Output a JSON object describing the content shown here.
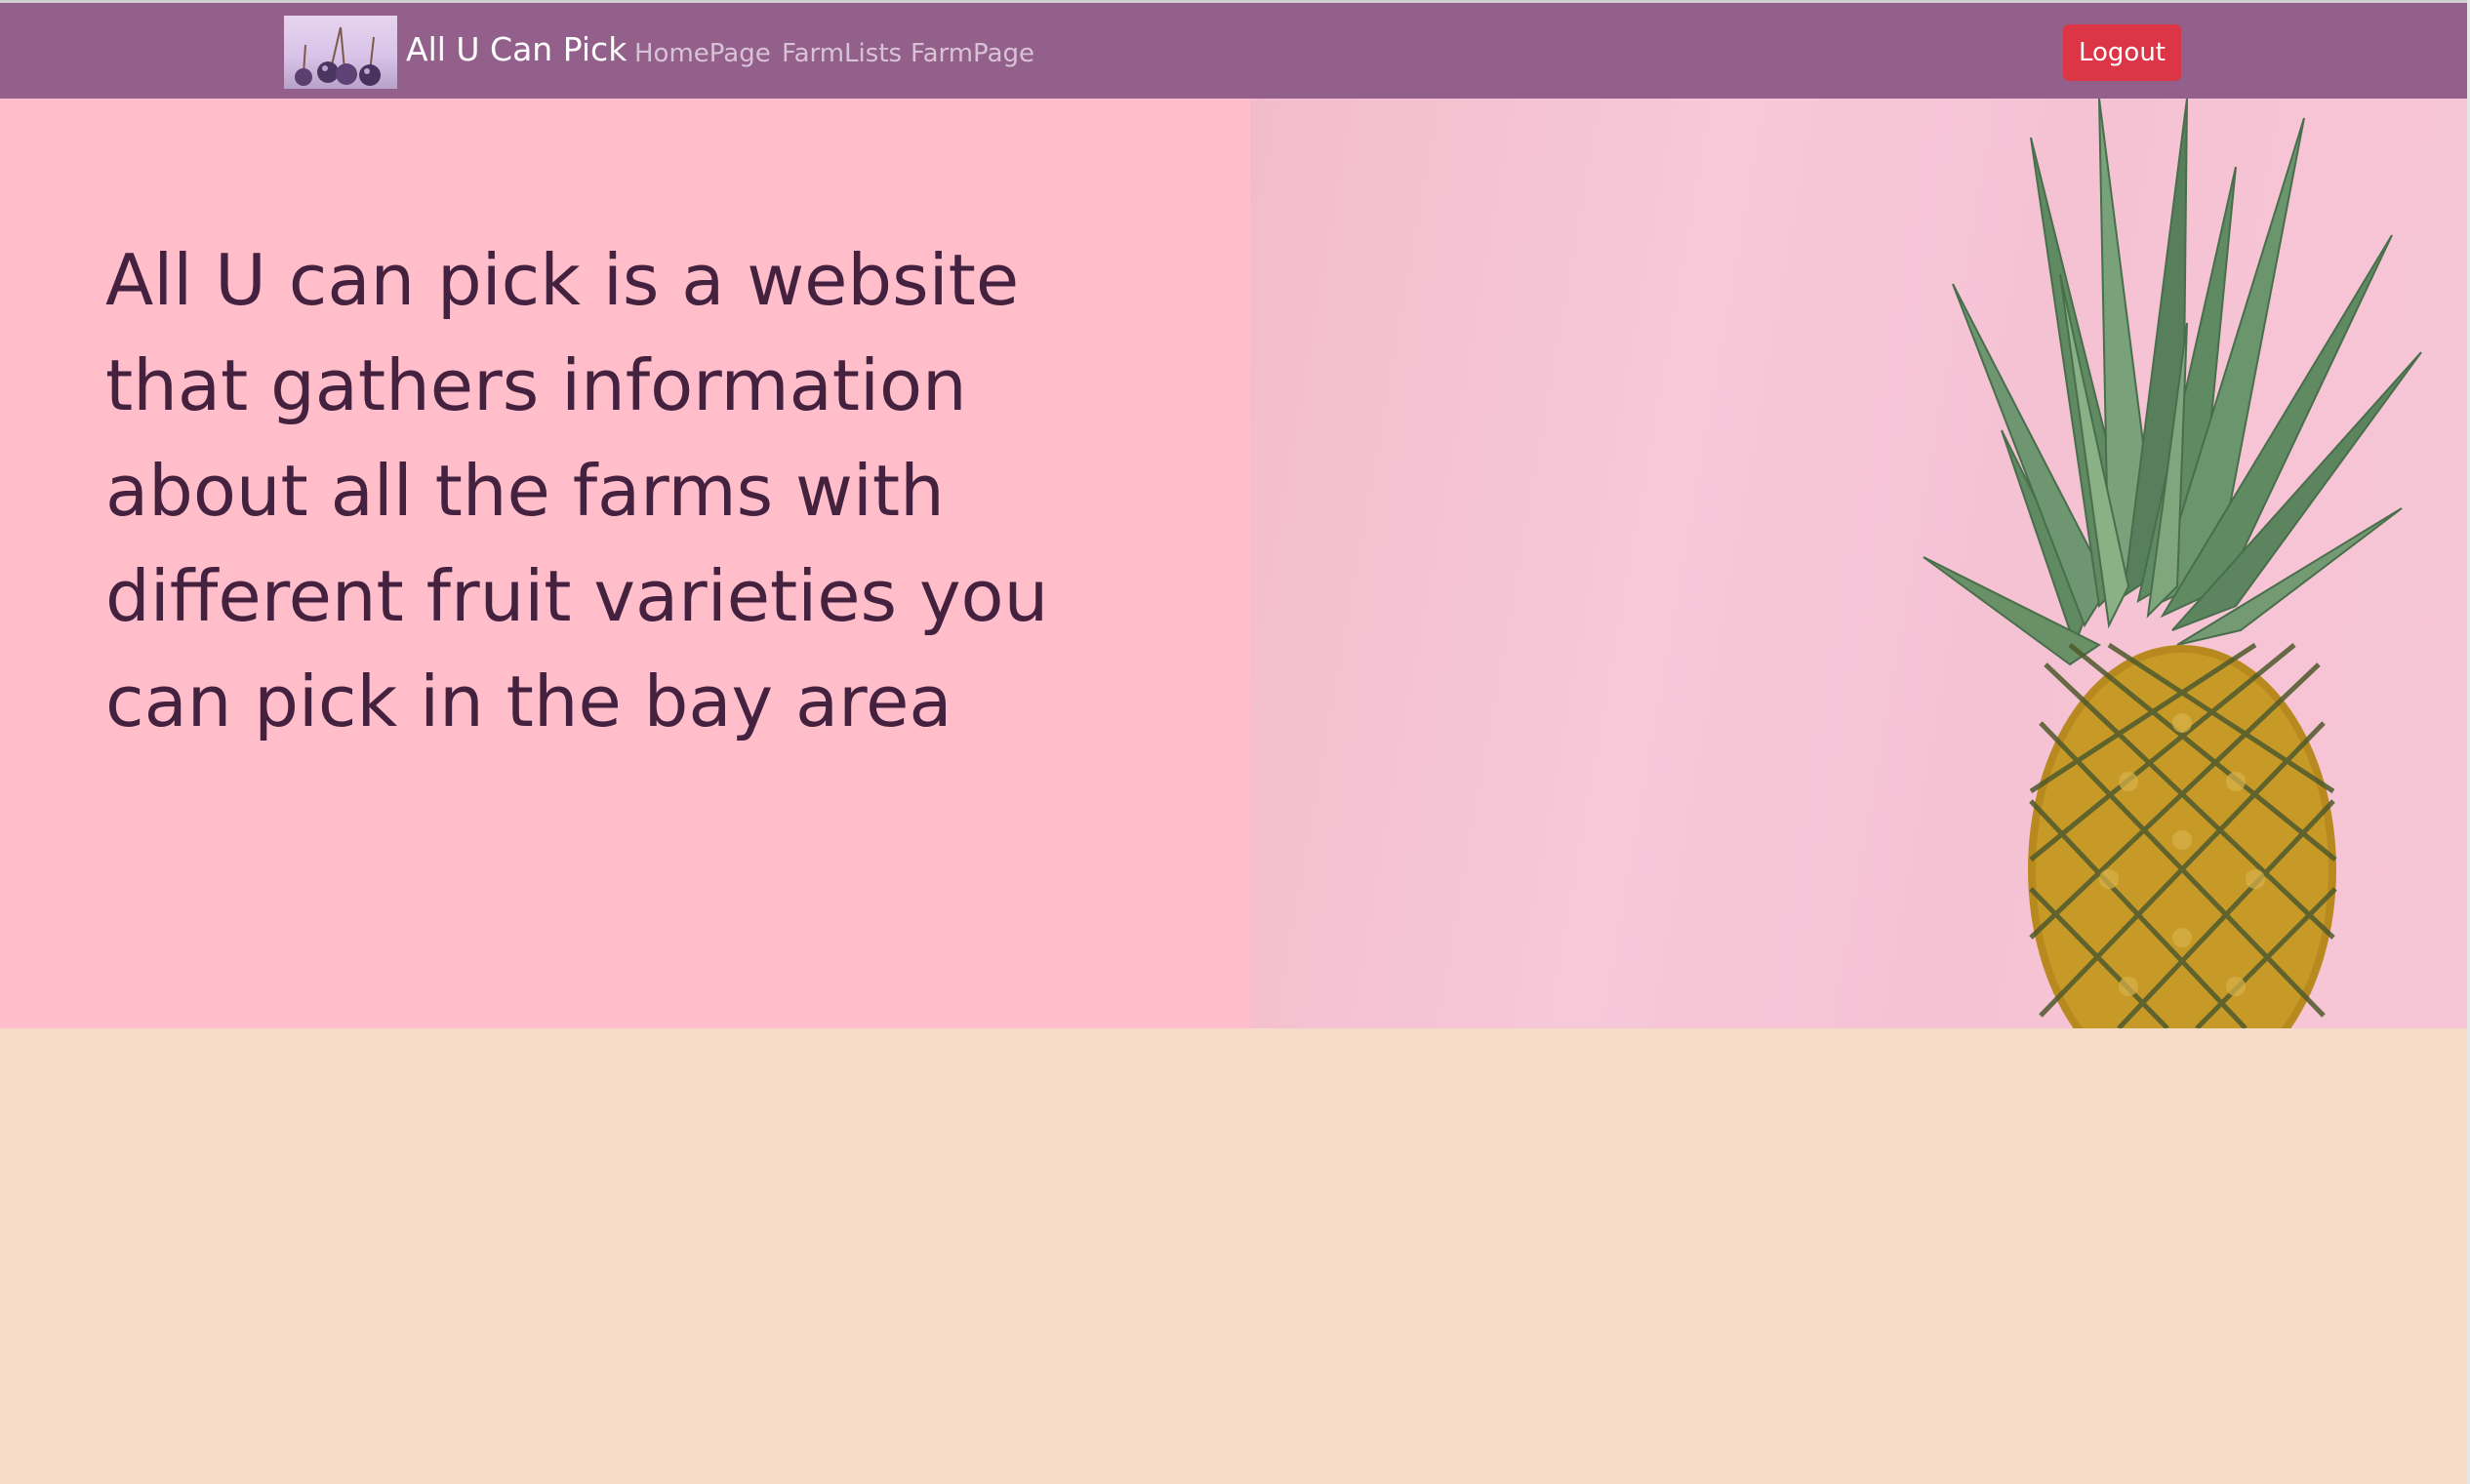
{
  "navbar": {
    "brand_name": "All U Can Pick",
    "logo_icon": "cherries-logo-icon",
    "links": [
      "HomePage",
      "FarmLists",
      "FarmPage"
    ],
    "logout_label": "Logout"
  },
  "hero": {
    "description": "All U can pick is a website that gathers information about all the farms with different fruit varieties you can pick in the bay area",
    "image_icon": "pineapple-image"
  },
  "colors": {
    "navbar": "#93608c",
    "logout": "#dc3545",
    "hero_left": "#ffbeca",
    "hero_text": "#43213f",
    "page_background": "#f5dcc9"
  }
}
